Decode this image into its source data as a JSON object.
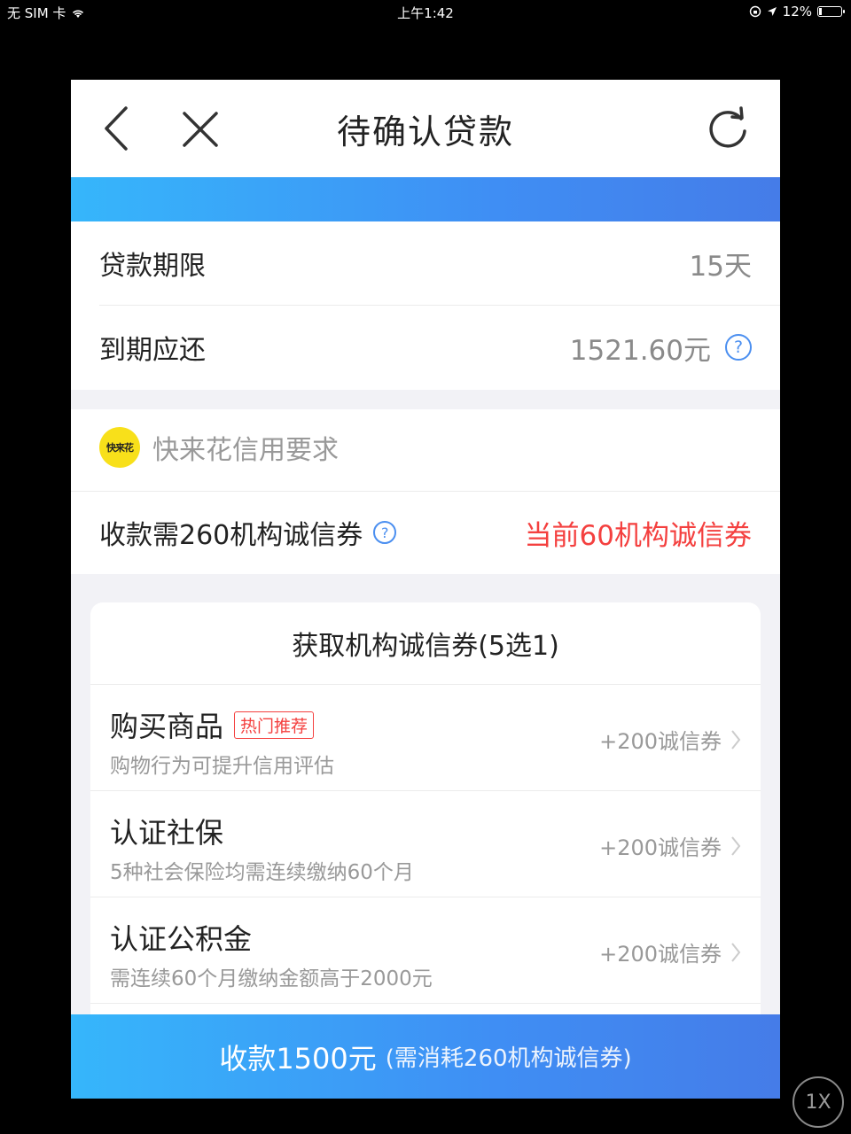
{
  "status_bar": {
    "carrier": "无 SIM 卡",
    "time": "上午1:42",
    "battery": "12%",
    "battery_level": 0.12
  },
  "nav": {
    "title": "待确认贷款"
  },
  "loan": {
    "term_label": "贷款期限",
    "term_value": "15天",
    "due_label": "到期应还",
    "due_value": "1521.60元"
  },
  "credit": {
    "brand_logo_text": "快来花",
    "brand_text": "快来花信用要求",
    "required_label": "收款需260机构诚信券",
    "current_label": "当前60机构诚信券"
  },
  "coupon_section": {
    "header": "获取机构诚信券(5选1)",
    "items": [
      {
        "title": "购买商品",
        "tag": "热门推荐",
        "desc": "购物行为可提升信用评估",
        "reward": "+200诚信券"
      },
      {
        "title": "认证社保",
        "tag": "",
        "desc": "5种社会保险均需连续缴纳60个月",
        "reward": "+200诚信券"
      },
      {
        "title": "认证公积金",
        "tag": "",
        "desc": "需连续60个月缴纳金额高于2000元",
        "reward": "+200诚信券"
      }
    ]
  },
  "bottom_button": {
    "main": "收款1500元",
    "sub": "(需消耗260机构诚信券)"
  },
  "zoom_label": "1X",
  "colors": {
    "accent_blue": "#3f8ef4",
    "alert_red": "#f4403f",
    "brand_yellow": "#f8e01a"
  }
}
